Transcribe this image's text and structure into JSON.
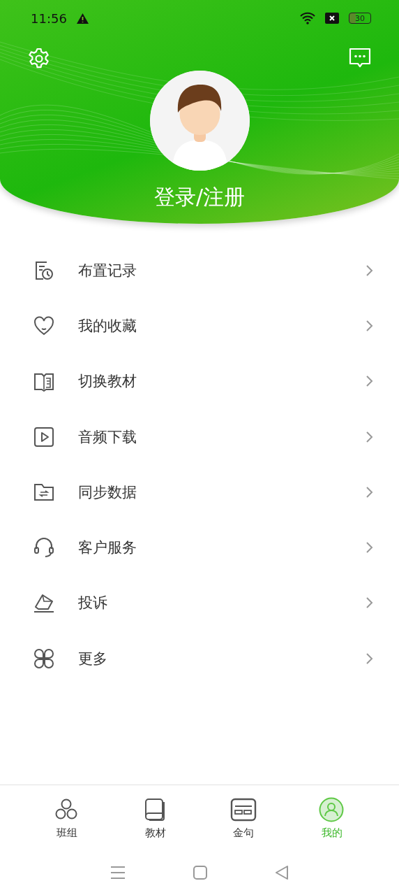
{
  "status_bar": {
    "time": "11:56",
    "battery": "30"
  },
  "header": {
    "login_label": "登录/注册"
  },
  "menu": [
    {
      "label": "布置记录"
    },
    {
      "label": "我的收藏"
    },
    {
      "label": "切换教材"
    },
    {
      "label": "音频下载"
    },
    {
      "label": "同步数据"
    },
    {
      "label": "客户服务"
    },
    {
      "label": "投诉"
    },
    {
      "label": "更多"
    }
  ],
  "tabs": [
    {
      "label": "班组",
      "selected": false
    },
    {
      "label": "教材",
      "selected": false
    },
    {
      "label": "金句",
      "selected": false
    },
    {
      "label": "我的",
      "selected": true
    }
  ]
}
